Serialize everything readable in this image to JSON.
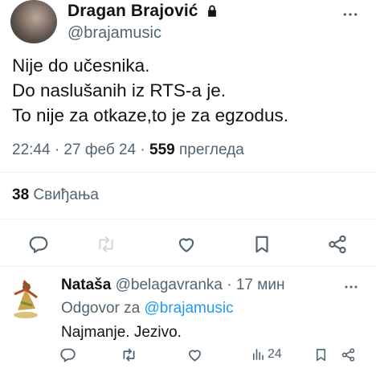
{
  "tweet": {
    "display_name": "Dragan Brajović",
    "handle": "@brajamusic",
    "text_lines": [
      "Nije do učesnika.",
      "Do naslušanih iz RTS-a je.",
      "To nije za otkaze,to je za egzodus."
    ],
    "time": "22:44 · 27 феб 24 · ",
    "views_count": "559",
    "views_label": " прегледа",
    "likes_count": "38",
    "likes_label": " Свиђања"
  },
  "reply": {
    "display_name": "Nataša",
    "handle_time": " @belagavranka · 17 мин",
    "reply_to_prefix": "Odgovor za ",
    "reply_to_mention": "@brajamusic",
    "text": "Najmanje. Jezivo.",
    "views": "24"
  },
  "icons": {
    "lock": "lock-icon",
    "more": "more-dots-icon",
    "reply": "comment-icon",
    "retweet": "retweet-icon",
    "like": "heart-icon",
    "bookmark": "bookmark-icon",
    "share": "share-icon",
    "views": "views-bar-icon"
  },
  "colors": {
    "text": "#0f1419",
    "secondary": "#536471",
    "link": "#1d9bf0",
    "divider": "#eff3f4",
    "retweet_disabled": "#cfd9de"
  }
}
